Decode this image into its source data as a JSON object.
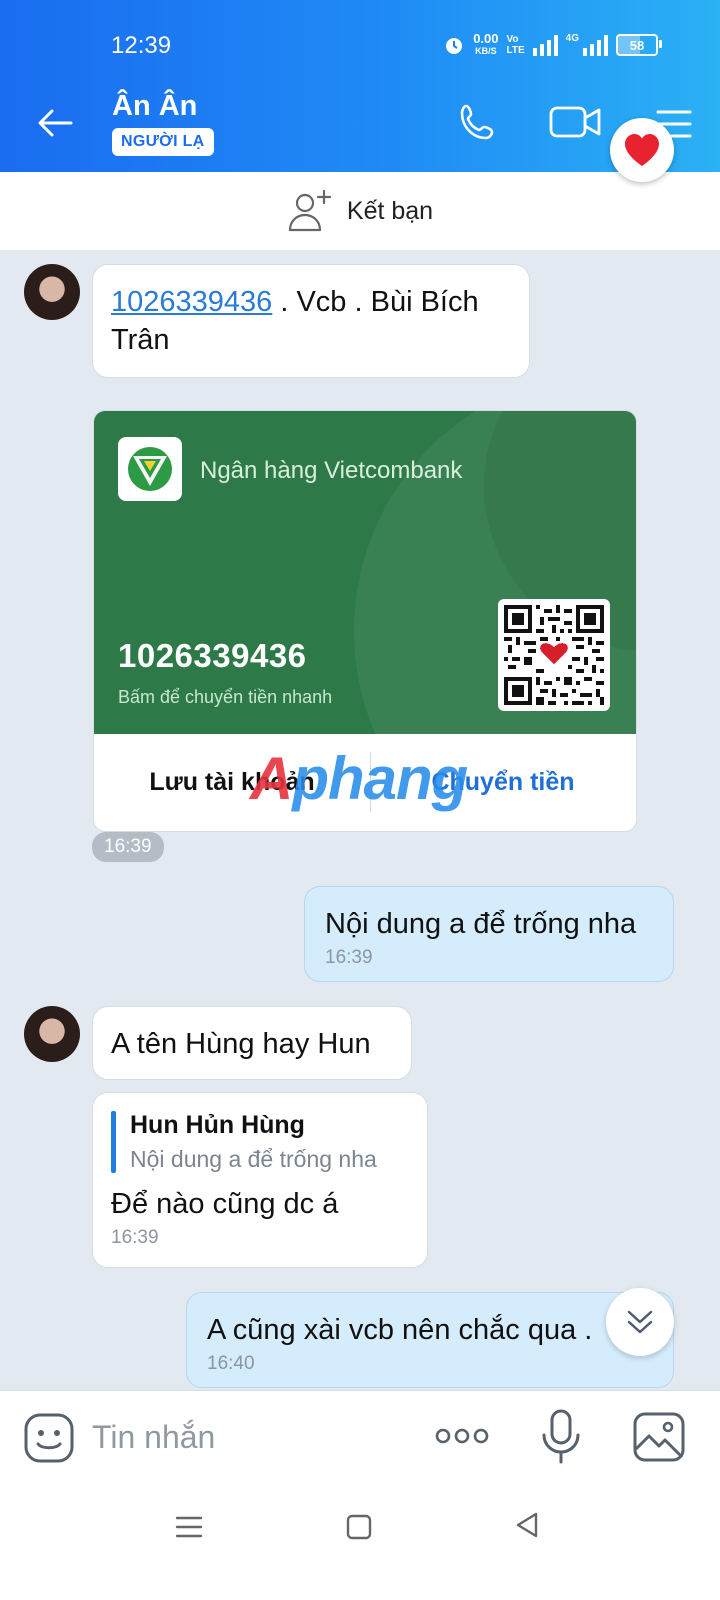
{
  "status": {
    "time": "12:39",
    "net_speed_value": "0.00",
    "net_speed_unit": "KB/S",
    "volte_top": "Vo",
    "volte_bottom": "LTE",
    "network": "4G",
    "battery": "58"
  },
  "header": {
    "contact_name": "Ân Ân",
    "badge": "NGƯỜI LẠ"
  },
  "add_friend": {
    "label": "Kết bạn"
  },
  "messages": {
    "m1": {
      "account": "1026339436",
      "rest": " . Vcb . Bùi Bích Trân"
    },
    "bank_card": {
      "bank_name": "Ngân hàng Vietcombank",
      "account_number": "1026339436",
      "hint": "Bấm để chuyển tiền nhanh",
      "save_label": "Lưu tài khoản",
      "transfer_label": "Chuyển tiền",
      "brand_color": "#2d7a48"
    },
    "time_chip": "16:39",
    "m2": {
      "text": "Nội dung a để trống nha",
      "time": "16:39"
    },
    "m3": {
      "text": "A tên Hùng hay Hun"
    },
    "m4": {
      "quote_name": "Hun Hủn Hùng",
      "quote_text": "Nội dung a để trống nha",
      "text": "Để nào cũng dc á",
      "time": "16:39"
    },
    "m5": {
      "text": "A cũng xài vcb nên chắc qua .",
      "time": "16:40"
    }
  },
  "watermark": {
    "a": "A",
    "rest": "phang"
  },
  "input": {
    "placeholder": "Tin nhắn"
  },
  "colors": {
    "header_gradient_start": "#1a6cf0",
    "header_gradient_end": "#2bb1f5",
    "my_bubble": "#d5ecfc",
    "chat_bg": "#e2e9f1",
    "link": "#2a7bd6"
  }
}
